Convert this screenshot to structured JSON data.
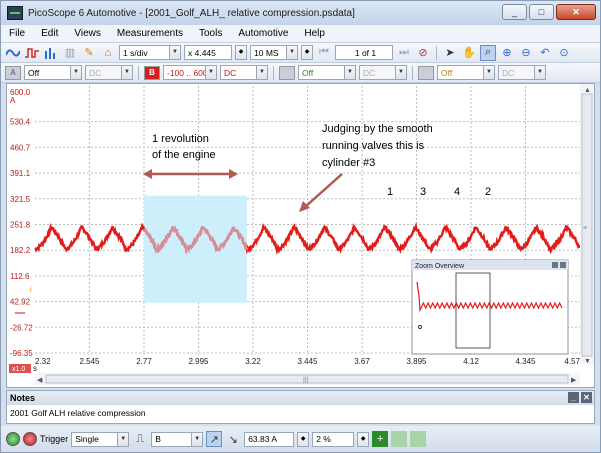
{
  "window": {
    "title": "PicoScope 6 Automotive - [2001_Golf_ALH_ relative compression.psdata]",
    "minimize": "_",
    "maximize": "□",
    "close": "✕"
  },
  "menu": [
    {
      "label": "File"
    },
    {
      "label": "Edit"
    },
    {
      "label": "Views"
    },
    {
      "label": "Measurements"
    },
    {
      "label": "Tools"
    },
    {
      "label": "Automotive"
    },
    {
      "label": "Help"
    }
  ],
  "toolbar1": {
    "timebase": "1 s/div",
    "zoom": "x 4.445",
    "samples": "10 MS",
    "buffer": "1 of 1"
  },
  "toolbar2": {
    "chA_letter": "A",
    "chA_range": "Off",
    "chA_coupling": "DC",
    "chB_letter": "B",
    "chB_range": "-100 .. 600",
    "chB_coupling": "DC",
    "chC_range": "Off",
    "chC_coupling": "DC",
    "chD_range": "Off",
    "chD_coupling": "DC"
  },
  "chart_data": {
    "type": "line",
    "units": "A",
    "y_ticks": [
      "530.4",
      "460.7",
      "391.1",
      "321.5",
      "251.8",
      "182.2",
      "112.6",
      "42.92",
      "-26.72",
      "-96.35"
    ],
    "y_top_label": "600.0",
    "y_axis_scale_label": "x1.0",
    "x_unit": "s",
    "x_ticks": [
      "2.32",
      "2.545",
      "2.77",
      "2.995",
      "3.22",
      "3.445",
      "3.67",
      "3.895",
      "4.12",
      "4.345",
      "4.57"
    ],
    "xlim": [
      2.32,
      4.57
    ],
    "ylim": [
      -96.35,
      600.0
    ],
    "series": [
      {
        "color": "#e21b1b",
        "peak": 245,
        "trough": 185,
        "cycles": 18
      }
    ],
    "highlight_region": {
      "x_start": 2.77,
      "x_end": 3.195
    }
  },
  "annotations": {
    "revolution_label": "1 revolution\nof the engine",
    "judging_label": "Judging by the smooth\nrunning valves this is\ncylinder #3",
    "cylinder_labels": [
      "1",
      "3",
      "4",
      "2"
    ]
  },
  "zoom_overview": {
    "title": "Zoom Overview"
  },
  "notes": {
    "header": "Notes",
    "text": "2001 Golf ALH relative compression"
  },
  "statusbar": {
    "trigger_label": "Trigger",
    "trigger_mode": "Single",
    "trigger_channel": "B",
    "threshold": "63.83 A",
    "pretrigger": "2 %"
  },
  "colors": {
    "trace": "#e21b1b",
    "highlight": "#cdeefb",
    "grid": "#bfbfbf"
  }
}
